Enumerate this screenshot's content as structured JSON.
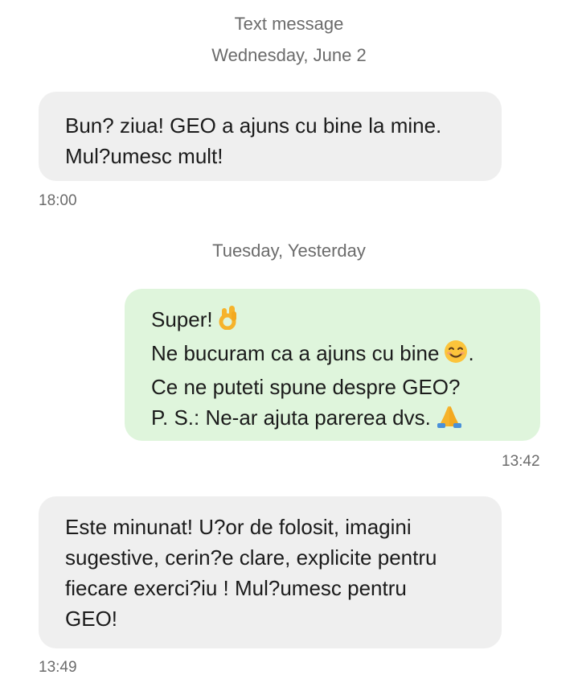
{
  "header": {
    "channel": "Text message",
    "date1": "Wednesday, June 2",
    "date2": "Tuesday, Yesterday"
  },
  "messages": [
    {
      "direction": "incoming",
      "lines": [
        "Bun? ziua! GEO a ajuns cu bine la mine.",
        "Mul?umesc mult!"
      ],
      "time": "18:00"
    },
    {
      "direction": "outgoing",
      "lines": [
        "Super!",
        "Ne bucuram ca a ajuns cu bine",
        ".",
        "Ce ne puteti spune despre GEO?",
        "P. S.: Ne-ar ajuta parerea dvs."
      ],
      "emojis": [
        "ok-hand-emoji",
        "smiling-face-emoji",
        "folded-hands-emoji"
      ],
      "time": "13:42"
    },
    {
      "direction": "incoming",
      "lines": [
        "Este minunat! U?or de folosit, imagini",
        "sugestive, cerin?e clare, explicite pentru",
        "fiecare exerci?iu ! Mul?umesc pentru",
        "GEO!"
      ],
      "time": "13:49"
    }
  ],
  "colors": {
    "incoming_bubble": "#efefef",
    "outgoing_bubble": "#dff5dc",
    "secondary_text": "#6b6b6b"
  }
}
